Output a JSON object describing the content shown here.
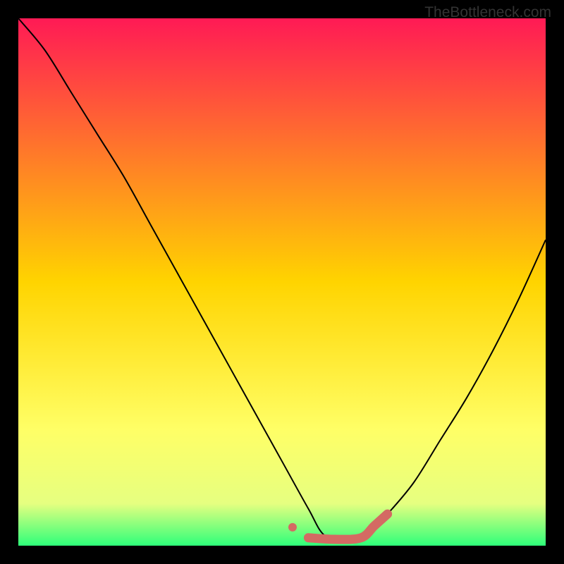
{
  "attribution": "TheBottleneck.com",
  "chart_data": {
    "type": "line",
    "title": "",
    "xlabel": "",
    "ylabel": "",
    "xlim": [
      0,
      100
    ],
    "ylim": [
      0,
      100
    ],
    "gradient_background": {
      "direction": "vertical",
      "stops": [
        {
          "offset": 0.0,
          "color": "#ff1a55"
        },
        {
          "offset": 0.5,
          "color": "#ffd400"
        },
        {
          "offset": 0.78,
          "color": "#ffff66"
        },
        {
          "offset": 0.92,
          "color": "#e6ff80"
        },
        {
          "offset": 1.0,
          "color": "#2eff7a"
        }
      ]
    },
    "optimal_band": {
      "color": "#d46a63",
      "left_dot_x": 52,
      "flat_start_x": 55,
      "flat_end_x": 65,
      "right_end_x": 70,
      "right_end_y": 6,
      "y_flat": 1.5
    },
    "series": [
      {
        "name": "bottleneck-curve",
        "color": "#000000",
        "x": [
          0,
          5,
          10,
          15,
          20,
          25,
          30,
          35,
          40,
          45,
          50,
          55,
          58,
          62,
          66,
          70,
          75,
          80,
          85,
          90,
          95,
          100
        ],
        "y": [
          100,
          94,
          86,
          78,
          70,
          61,
          52,
          43,
          34,
          25,
          16,
          7,
          2,
          1,
          2,
          6,
          12,
          20,
          28,
          37,
          47,
          58
        ]
      }
    ]
  }
}
